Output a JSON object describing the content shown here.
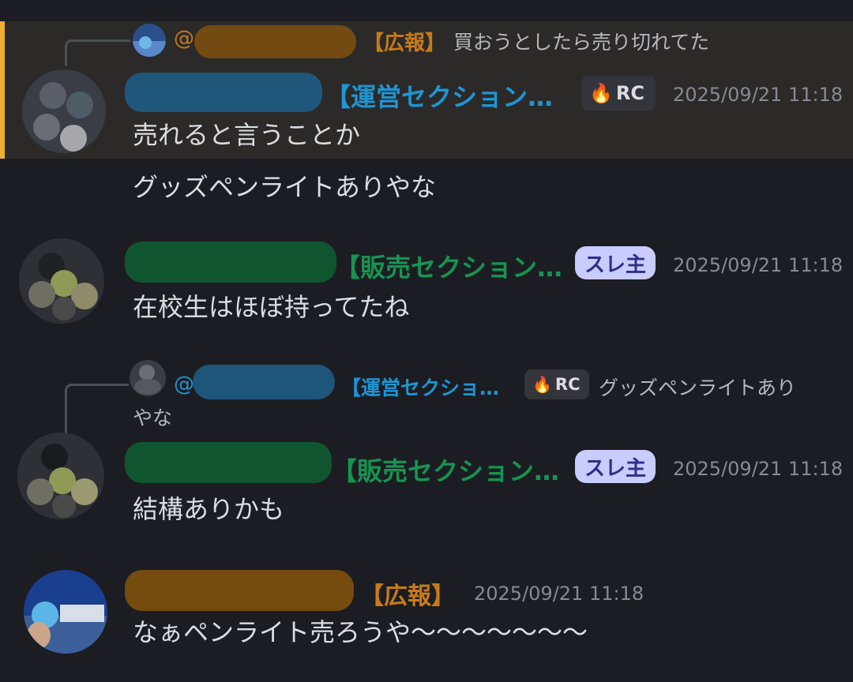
{
  "messages": {
    "m1": {
      "reply_at": "@",
      "reply_section": "【広報】",
      "reply_text": "買おうとしたら売り切れてた",
      "section": "【運営セクション…",
      "role_tag": "RC",
      "timestamp": "2025/09/21 11:18",
      "text": "売れると言うことか"
    },
    "m2": {
      "text": "グッズペンライトありやな"
    },
    "m3": {
      "section": "【販売セクション…",
      "role_tag": "スレ主",
      "timestamp": "2025/09/21 11:18",
      "text": "在校生はほぼ持ってたね"
    },
    "m4": {
      "reply_at": "@",
      "reply_section": "【運営セクショ…",
      "reply_role_tag": "RC",
      "reply_text_line1": "グッズペンライトあり",
      "reply_text_line2": "やな",
      "section": "【販売セクション…",
      "role_tag": "スレ主",
      "timestamp": "2025/09/21 11:18",
      "text": "結構ありかも"
    },
    "m5": {
      "section": "【広報】",
      "timestamp": "2025/09/21 11:18",
      "text": "なぁペンライト売ろうや〜〜〜〜〜〜〜"
    }
  },
  "colors": {
    "highlight_bar": "#f0b132",
    "section_blue": "#1e95d4",
    "section_green": "#159452",
    "section_orange": "#c77b17",
    "op_tag_bg": "#c9ccff"
  },
  "icons": {
    "role_rc": "flame-icon"
  }
}
